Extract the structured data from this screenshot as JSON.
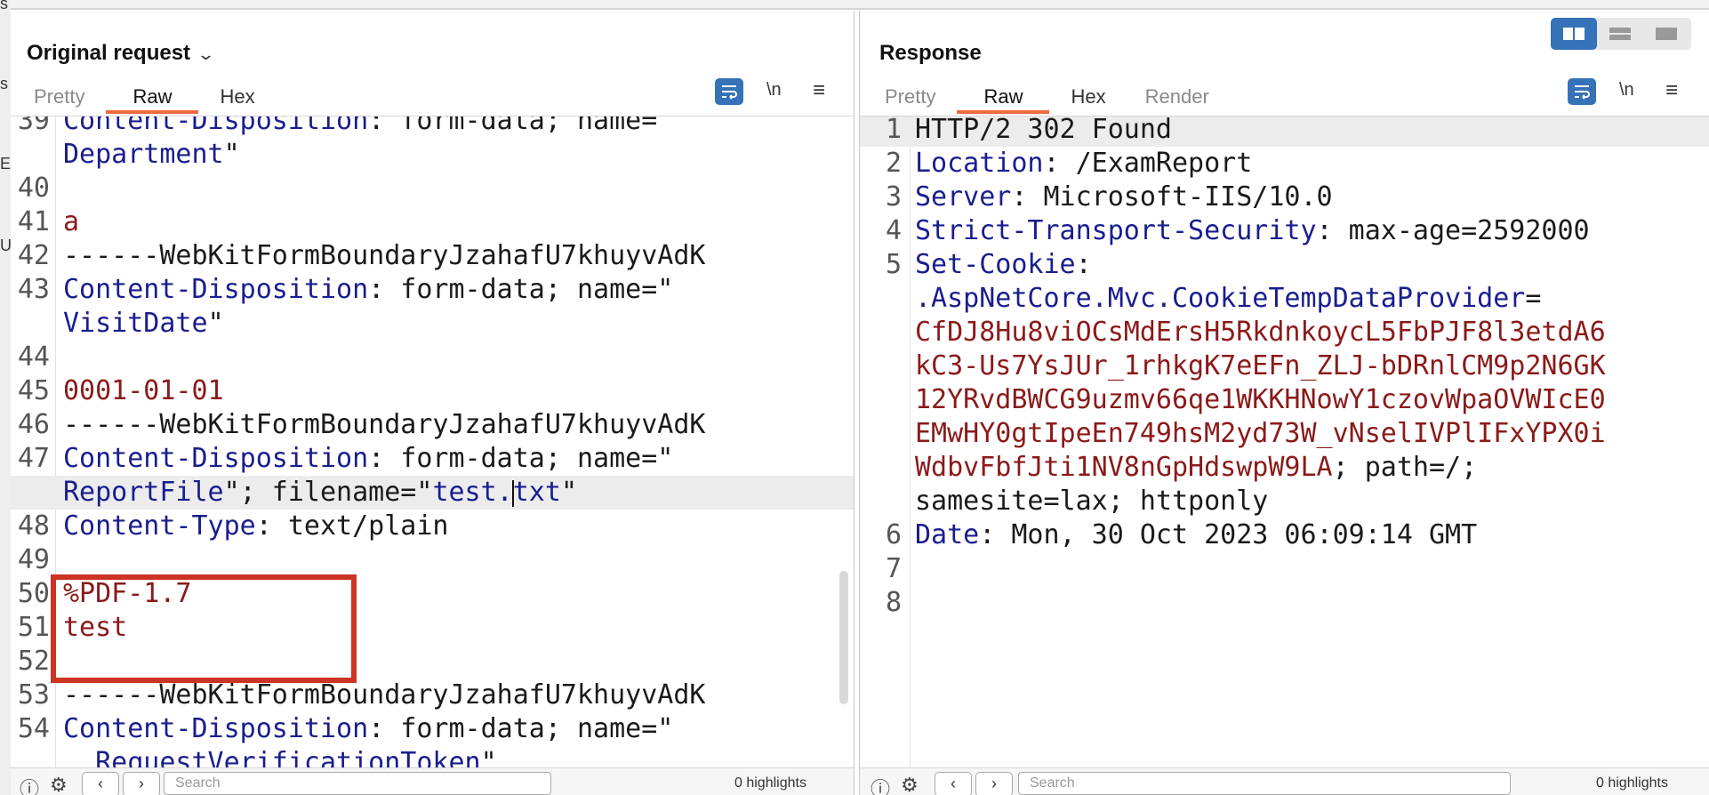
{
  "left_strip_chars": [
    "s",
    "s",
    "E",
    "U"
  ],
  "left": {
    "title": "Original request",
    "title_icon": "chevron-down-icon",
    "tabs": [
      "Pretty",
      "Raw",
      "Hex"
    ],
    "active_tab": "Raw",
    "newline_label": "\\n",
    "lines": [
      {
        "n": "39",
        "parts": [
          [
            "k",
            "Content-Disposition"
          ],
          [
            "v",
            ": form-data; name=\""
          ]
        ]
      },
      {
        "n": "",
        "parts": [
          [
            "k",
            "Department"
          ],
          [
            "v",
            "\""
          ]
        ]
      },
      {
        "n": "40",
        "parts": []
      },
      {
        "n": "41",
        "parts": [
          [
            "r",
            "a"
          ]
        ]
      },
      {
        "n": "42",
        "parts": [
          [
            "v",
            "------WebKitFormBoundaryJzahafU7khuyvAdK"
          ]
        ]
      },
      {
        "n": "43",
        "parts": [
          [
            "k",
            "Content-Disposition"
          ],
          [
            "v",
            ": form-data; name=\""
          ]
        ]
      },
      {
        "n": "",
        "parts": [
          [
            "k",
            "VisitDate"
          ],
          [
            "v",
            "\""
          ]
        ]
      },
      {
        "n": "44",
        "parts": []
      },
      {
        "n": "45",
        "parts": [
          [
            "r",
            "0001-01-01"
          ]
        ]
      },
      {
        "n": "46",
        "parts": [
          [
            "v",
            "------WebKitFormBoundaryJzahafU7khuyvAdK"
          ]
        ]
      },
      {
        "n": "47",
        "parts": [
          [
            "k",
            "Content-Disposition"
          ],
          [
            "v",
            ": form-data; name=\""
          ]
        ]
      },
      {
        "n": "",
        "parts": [
          [
            "k",
            "ReportFile"
          ],
          [
            "v",
            "\"; filename=\""
          ],
          [
            "k",
            "test."
          ],
          [
            "caret",
            ""
          ],
          [
            "k",
            "txt"
          ],
          [
            "v",
            "\""
          ]
        ],
        "highlight": true
      },
      {
        "n": "48",
        "parts": [
          [
            "k",
            "Content-Type"
          ],
          [
            "v",
            ": text/plain"
          ]
        ]
      },
      {
        "n": "49",
        "parts": []
      },
      {
        "n": "50",
        "parts": [
          [
            "r",
            "%PDF-1.7"
          ]
        ]
      },
      {
        "n": "51",
        "parts": [
          [
            "r",
            "test"
          ]
        ]
      },
      {
        "n": "52",
        "parts": []
      },
      {
        "n": "53",
        "parts": [
          [
            "v",
            "------WebKitFormBoundaryJzahafU7khuyvAdK"
          ]
        ]
      },
      {
        "n": "54",
        "parts": [
          [
            "k",
            "Content-Disposition"
          ],
          [
            "v",
            ": form-data; name=\""
          ]
        ]
      },
      {
        "n": "",
        "parts": [
          [
            "k",
            "  RequestVerificationToken"
          ],
          [
            "v",
            "\""
          ]
        ]
      }
    ],
    "search_placeholder": "Search",
    "highlights": "0 highlights"
  },
  "right": {
    "title": "Response",
    "tabs": [
      "Pretty",
      "Raw",
      "Hex",
      "Render"
    ],
    "active_tab": "Raw",
    "newline_label": "\\n",
    "lines": [
      {
        "n": "1",
        "parts": [
          [
            "v",
            "HTTP/2 302 Found"
          ]
        ],
        "highlight": true
      },
      {
        "n": "2",
        "parts": [
          [
            "k",
            "Location"
          ],
          [
            "v",
            ": /ExamReport"
          ]
        ]
      },
      {
        "n": "3",
        "parts": [
          [
            "k",
            "Server"
          ],
          [
            "v",
            ": Microsoft-IIS/10.0"
          ]
        ]
      },
      {
        "n": "4",
        "parts": [
          [
            "k",
            "Strict-Transport-Security"
          ],
          [
            "v",
            ": max-age=2592000"
          ]
        ]
      },
      {
        "n": "5",
        "parts": [
          [
            "k",
            "Set-Cookie"
          ],
          [
            "v",
            ":"
          ]
        ]
      },
      {
        "n": "",
        "parts": [
          [
            "k",
            ".AspNetCore.Mvc.CookieTempDataProvider"
          ],
          [
            "v",
            "="
          ]
        ]
      },
      {
        "n": "",
        "parts": [
          [
            "r",
            "CfDJ8Hu8viOCsMdErsH5RkdnkoycL5FbPJF8l3etdA6"
          ]
        ]
      },
      {
        "n": "",
        "parts": [
          [
            "r",
            "kC3-Us7YsJUr_1rhkgK7eEFn_ZLJ-bDRnlCM9p2N6GK"
          ]
        ]
      },
      {
        "n": "",
        "parts": [
          [
            "r",
            "12YRvdBWCG9uzmv66qe1WKKHNowY1czovWpaOVWIcE0"
          ]
        ]
      },
      {
        "n": "",
        "parts": [
          [
            "r",
            "EMwHY0gtIpeEn749hsM2yd73W_vNselIVPlIFxYPX0i"
          ]
        ]
      },
      {
        "n": "",
        "parts": [
          [
            "r",
            "WdbvFbfJti1NV8nGpHdswpW9LA"
          ],
          [
            "v",
            "; path=/;"
          ]
        ]
      },
      {
        "n": "",
        "parts": [
          [
            "v",
            "samesite=lax; httponly"
          ]
        ]
      },
      {
        "n": "6",
        "parts": [
          [
            "k",
            "Date"
          ],
          [
            "v",
            ": Mon, 30 Oct 2023 06:09:14 GMT"
          ]
        ]
      },
      {
        "n": "7",
        "parts": []
      },
      {
        "n": "8",
        "parts": []
      }
    ],
    "search_placeholder": "Search",
    "highlights": "0 highlights"
  },
  "colors": {
    "accent_tab": "#f06a3d",
    "toolbar_blue": "#3572b7",
    "header_key": "#1a1d8f",
    "value_red": "#8b1a1a",
    "red_box": "#cc3322"
  }
}
